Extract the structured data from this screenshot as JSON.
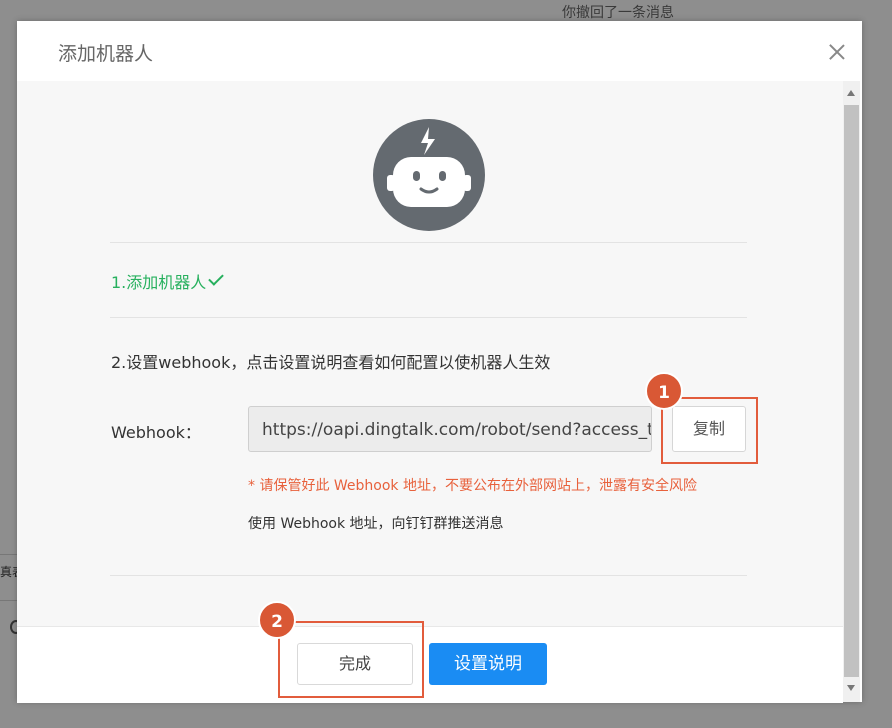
{
  "background": {
    "toast": "你撤回了一条消息",
    "left_fragment": "真表"
  },
  "dialog": {
    "title": "添加机器人",
    "step1": "1.添加机器人",
    "step2": "2.设置webhook，点击设置说明查看如何配置以使机器人生效",
    "webhook_label": "Webhook：",
    "webhook_value": "https://oapi.dingtalk.com/robot/send?access_token=",
    "copy_label": "复制",
    "warning": "* 请保管好此 Webhook 地址，不要公布在外部网站上，泄露有安全风险",
    "usage": "使用 Webhook 地址，向钉钉群推送消息",
    "done_label": "完成",
    "help_label": "设置说明"
  },
  "annotations": [
    {
      "number": "1",
      "target": "copy-button"
    },
    {
      "number": "2",
      "target": "done-button"
    }
  ],
  "colors": {
    "success": "#27b05e",
    "warning": "#e8613c",
    "primary": "#1a8cf3",
    "annotation": "#d95835",
    "avatar": "#646a70"
  },
  "icons": {
    "avatar": "robot-icon",
    "close": "close-icon",
    "check": "check-icon"
  }
}
